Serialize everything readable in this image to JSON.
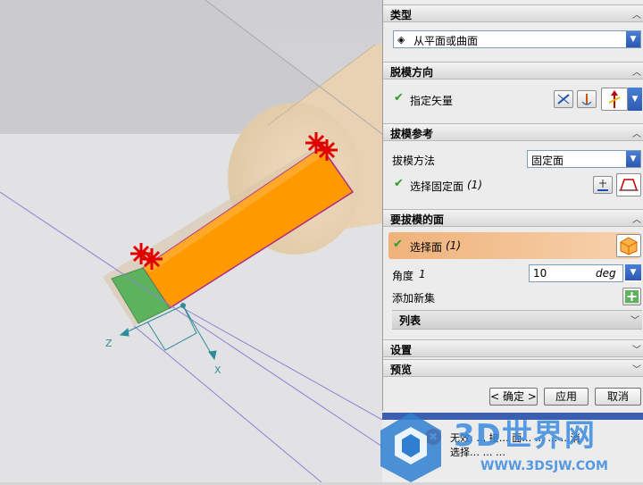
{
  "sections": {
    "type": {
      "title": "类型",
      "combo_value": "从平面或曲面"
    },
    "draft_direction": {
      "title": "脱模方向",
      "specify_vector": "指定矢量"
    },
    "draft_reference": {
      "title": "拔模参考",
      "method_label": "拔模方法",
      "method_value": "固定面",
      "select_fixed_face": "选择固定面",
      "select_fixed_face_count": "(1)"
    },
    "faces_to_draft": {
      "title": "要拔模的面",
      "select_face": "选择面",
      "select_face_count": "(1)",
      "angle_label": "角度",
      "angle_index": "1",
      "angle_value": "10",
      "angle_unit": "deg",
      "add_new_set": "添加新集",
      "list_label": "列表"
    },
    "settings": {
      "title": "设置"
    },
    "preview": {
      "title": "预览"
    }
  },
  "buttons": {
    "ok": "< 确定 >",
    "apply": "应用",
    "cancel": "取消"
  },
  "status_text": {
    "line1": "无效:  …  接…  面…  …  …  …消",
    "line2": "选择…  …  …"
  },
  "axes": {
    "x": "X",
    "z": "Z"
  },
  "watermark": {
    "main": "3D世界网",
    "url": "WWW.3DSJW.COM"
  },
  "colors": {
    "panel_bg": "#ececec",
    "selected_row": "#f0b27a",
    "face_orange": "#ff9900",
    "face_green": "#5db35d",
    "marker_red": "#e00000",
    "axis_blue": "#2e8b9a"
  }
}
